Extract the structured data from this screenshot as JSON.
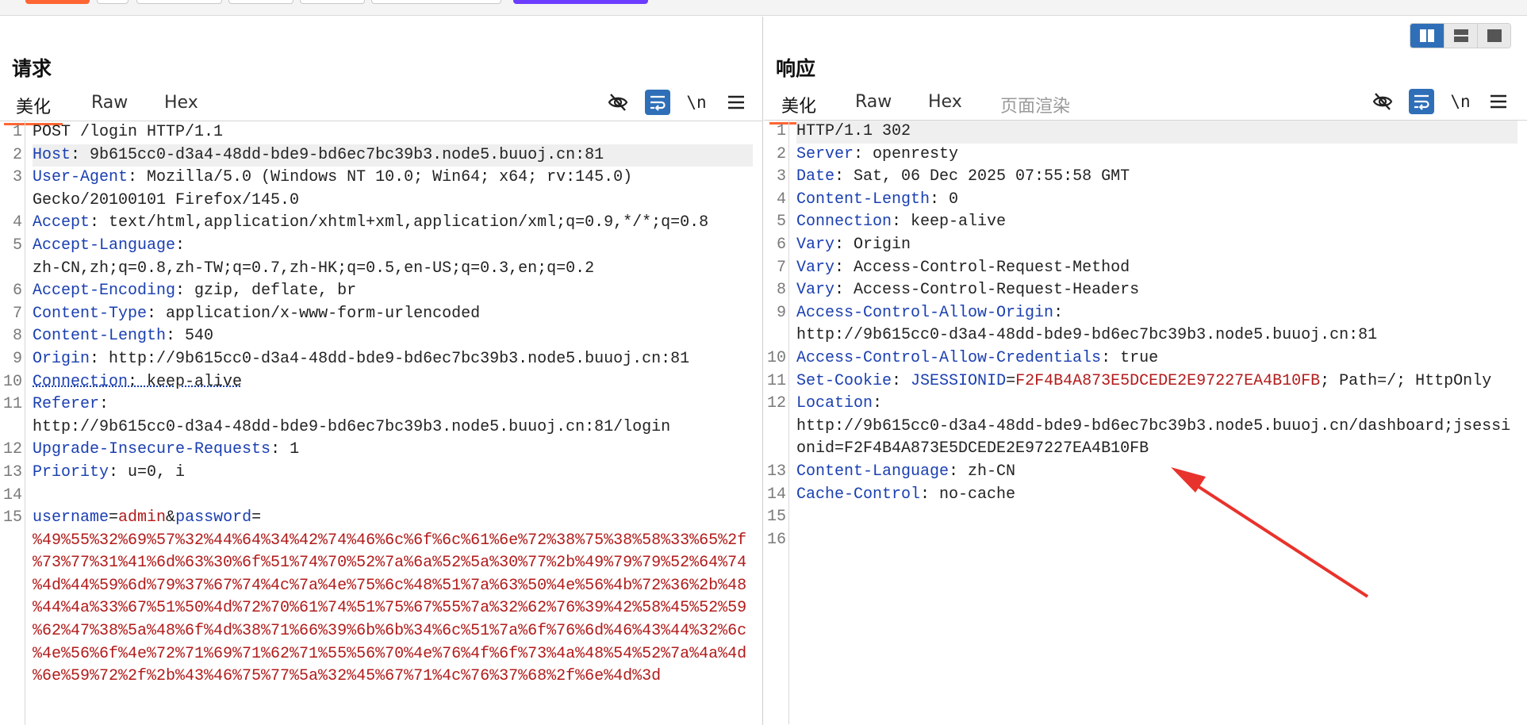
{
  "request": {
    "title": "请求",
    "tabs": [
      "美化",
      "Raw",
      "Hex"
    ],
    "tools": {
      "hide_icon": "eye-off-icon",
      "wrap_icon": "wrap-icon",
      "newline_label": "\\n",
      "menu_icon": "hamburger-menu-icon"
    },
    "lines": [
      {
        "n": "1",
        "parts": [
          {
            "t": "POST /login HTTP/1.1",
            "c": "v"
          }
        ]
      },
      {
        "n": "2",
        "hl": true,
        "parts": [
          {
            "t": "Host",
            "c": "k"
          },
          {
            "t": ": 9b615cc0-d3a4-48dd-bde9-bd6ec7bc39b3.node5.buuoj.cn:81",
            "c": "v"
          }
        ]
      },
      {
        "n": "3",
        "parts": [
          {
            "t": "User-Agent",
            "c": "k"
          },
          {
            "t": ": Mozilla/5.0 (Windows NT 10.0; Win64; x64; rv:145.0)",
            "c": "v"
          }
        ]
      },
      {
        "n": "",
        "parts": [
          {
            "t": "Gecko/20100101 Firefox/145.0",
            "c": "v"
          }
        ]
      },
      {
        "n": "4",
        "parts": [
          {
            "t": "Accept",
            "c": "k"
          },
          {
            "t": ": text/html,application/xhtml+xml,application/xml;q=0.9,*/*;q=0.8",
            "c": "v"
          }
        ]
      },
      {
        "n": "5",
        "parts": [
          {
            "t": "Accept-Language",
            "c": "k"
          },
          {
            "t": ":",
            "c": "v"
          }
        ]
      },
      {
        "n": "",
        "parts": [
          {
            "t": "zh-CN,zh;q=0.8,zh-TW;q=0.7,zh-HK;q=0.5,en-US;q=0.3,en;q=0.2",
            "c": "v"
          }
        ]
      },
      {
        "n": "6",
        "parts": [
          {
            "t": "Accept-Encoding",
            "c": "k"
          },
          {
            "t": ": gzip, deflate, br",
            "c": "v"
          }
        ]
      },
      {
        "n": "7",
        "parts": [
          {
            "t": "Content-Type",
            "c": "k"
          },
          {
            "t": ": application/x-www-form-urlencoded",
            "c": "v"
          }
        ]
      },
      {
        "n": "8",
        "parts": [
          {
            "t": "Content-Length",
            "c": "k"
          },
          {
            "t": ": 540",
            "c": "v"
          }
        ]
      },
      {
        "n": "9",
        "parts": [
          {
            "t": "Origin",
            "c": "k"
          },
          {
            "t": ": http://9b615cc0-d3a4-48dd-bde9-bd6ec7bc39b3.node5.buuoj.cn:81",
            "c": "v"
          }
        ]
      },
      {
        "n": "10",
        "parts": [
          {
            "t": "Connection",
            "c": "k dotted"
          },
          {
            "t": ": keep-alive",
            "c": "v dotted"
          }
        ]
      },
      {
        "n": "11",
        "parts": [
          {
            "t": "Referer",
            "c": "k"
          },
          {
            "t": ":",
            "c": "v"
          }
        ]
      },
      {
        "n": "",
        "parts": [
          {
            "t": "http://9b615cc0-d3a4-48dd-bde9-bd6ec7bc39b3.node5.buuoj.cn:81/login",
            "c": "v"
          }
        ]
      },
      {
        "n": "12",
        "parts": [
          {
            "t": "Upgrade-Insecure-Requests",
            "c": "k"
          },
          {
            "t": ": 1",
            "c": "v"
          }
        ]
      },
      {
        "n": "13",
        "parts": [
          {
            "t": "Priority",
            "c": "k"
          },
          {
            "t": ": u=0, i",
            "c": "v"
          }
        ]
      },
      {
        "n": "14",
        "parts": [
          {
            "t": "",
            "c": "v"
          }
        ]
      },
      {
        "n": "15",
        "parts": [
          {
            "t": "username",
            "c": "k"
          },
          {
            "t": "=",
            "c": "v"
          },
          {
            "t": "admin",
            "c": "r"
          },
          {
            "t": "&",
            "c": "v"
          },
          {
            "t": "password",
            "c": "k"
          },
          {
            "t": "=",
            "c": "v"
          }
        ]
      },
      {
        "n": "",
        "parts": [
          {
            "t": "%49%55%32%69%57%32%44%64%34%42%74%46%6c%6f%6c%61%6e%72%38%75%38%58%33%65%2f",
            "c": "r"
          }
        ]
      },
      {
        "n": "",
        "parts": [
          {
            "t": "%73%77%31%41%6d%63%30%6f%51%74%70%52%7a%6a%52%5a%30%77%2b%49%79%79%52%64%74",
            "c": "r"
          }
        ]
      },
      {
        "n": "",
        "parts": [
          {
            "t": "%4d%44%59%6d%79%37%67%74%4c%7a%4e%75%6c%48%51%7a%63%50%4e%56%4b%72%36%2b%48",
            "c": "r"
          }
        ]
      },
      {
        "n": "",
        "parts": [
          {
            "t": "%44%4a%33%67%51%50%4d%72%70%61%74%51%75%67%55%7a%32%62%76%39%42%58%45%52%59",
            "c": "r"
          }
        ]
      },
      {
        "n": "",
        "parts": [
          {
            "t": "%62%47%38%5a%48%6f%4d%38%71%66%39%6b%6b%34%6c%51%7a%6f%76%6d%46%43%44%32%6c",
            "c": "r"
          }
        ]
      },
      {
        "n": "",
        "parts": [
          {
            "t": "%4e%56%6f%4e%72%71%69%71%62%71%55%56%70%4e%76%4f%6f%73%4a%48%54%52%7a%4a%4d",
            "c": "r"
          }
        ]
      },
      {
        "n": "",
        "parts": [
          {
            "t": "%6e%59%72%2f%2b%43%46%75%77%5a%32%45%67%71%4c%76%37%68%2f%6e%4d%3d",
            "c": "r"
          }
        ]
      }
    ]
  },
  "response": {
    "title": "响应",
    "tabs": [
      "美化",
      "Raw",
      "Hex",
      "页面渲染"
    ],
    "tools": {
      "hide_icon": "eye-off-icon",
      "wrap_icon": "wrap-icon",
      "newline_label": "\\n",
      "menu_icon": "hamburger-menu-icon"
    },
    "lines": [
      {
        "n": "1",
        "hl": true,
        "parts": [
          {
            "t": "HTTP/1.1 302",
            "c": "v"
          }
        ]
      },
      {
        "n": "2",
        "parts": [
          {
            "t": "Server",
            "c": "k"
          },
          {
            "t": ": openresty",
            "c": "v"
          }
        ]
      },
      {
        "n": "3",
        "parts": [
          {
            "t": "Date",
            "c": "k"
          },
          {
            "t": ": Sat, 06 Dec 2025 07:55:58 GMT",
            "c": "v"
          }
        ]
      },
      {
        "n": "4",
        "parts": [
          {
            "t": "Content-Length",
            "c": "k"
          },
          {
            "t": ": 0",
            "c": "v"
          }
        ]
      },
      {
        "n": "5",
        "parts": [
          {
            "t": "Connection",
            "c": "k"
          },
          {
            "t": ": keep-alive",
            "c": "v"
          }
        ]
      },
      {
        "n": "6",
        "parts": [
          {
            "t": "Vary",
            "c": "k"
          },
          {
            "t": ": Origin",
            "c": "v"
          }
        ]
      },
      {
        "n": "7",
        "parts": [
          {
            "t": "Vary",
            "c": "k"
          },
          {
            "t": ": Access-Control-Request-Method",
            "c": "v"
          }
        ]
      },
      {
        "n": "8",
        "parts": [
          {
            "t": "Vary",
            "c": "k"
          },
          {
            "t": ": Access-Control-Request-Headers",
            "c": "v"
          }
        ]
      },
      {
        "n": "9",
        "parts": [
          {
            "t": "Access-Control-Allow-Origin",
            "c": "k"
          },
          {
            "t": ":",
            "c": "v"
          }
        ]
      },
      {
        "n": "",
        "parts": [
          {
            "t": "http://9b615cc0-d3a4-48dd-bde9-bd6ec7bc39b3.node5.buuoj.cn:81",
            "c": "v"
          }
        ]
      },
      {
        "n": "10",
        "parts": [
          {
            "t": "Access-Control-Allow-Credentials",
            "c": "k"
          },
          {
            "t": ": true",
            "c": "v"
          }
        ]
      },
      {
        "n": "11",
        "parts": [
          {
            "t": "Set-Cookie",
            "c": "k"
          },
          {
            "t": ": ",
            "c": "v"
          },
          {
            "t": "JSESSIONID",
            "c": "k"
          },
          {
            "t": "=",
            "c": "v"
          },
          {
            "t": "F2F4B4A873E5DCEDE2E97227EA4B10FB",
            "c": "r"
          },
          {
            "t": "; Path=/; HttpOnly",
            "c": "v"
          }
        ]
      },
      {
        "n": "12",
        "parts": [
          {
            "t": "Location",
            "c": "k"
          },
          {
            "t": ":",
            "c": "v"
          }
        ]
      },
      {
        "n": "",
        "parts": [
          {
            "t": "http://9b615cc0-d3a4-48dd-bde9-bd6ec7bc39b3.node5.buuoj.cn/dashboard;jsessi",
            "c": "v"
          }
        ]
      },
      {
        "n": "",
        "parts": [
          {
            "t": "onid=F2F4B4A873E5DCEDE2E97227EA4B10FB",
            "c": "v"
          }
        ]
      },
      {
        "n": "13",
        "parts": [
          {
            "t": "Content-Language",
            "c": "k"
          },
          {
            "t": ": zh-CN",
            "c": "v"
          }
        ]
      },
      {
        "n": "14",
        "parts": [
          {
            "t": "Cache-Control",
            "c": "k"
          },
          {
            "t": ": no-cache",
            "c": "v"
          }
        ]
      },
      {
        "n": "15",
        "parts": [
          {
            "t": "",
            "c": "v"
          }
        ]
      },
      {
        "n": "16",
        "parts": [
          {
            "t": "",
            "c": "v"
          }
        ]
      }
    ]
  },
  "layout_buttons": [
    "split-horizontal-icon",
    "split-vertical-icon",
    "single-pane-icon"
  ],
  "annotation": {
    "arrow_color": "#e8332c",
    "arrow_icon": "red-arrow-annotation"
  },
  "colors": {
    "accent": "#ff6633",
    "header_key": "#1a3fb0",
    "value_red": "#b31b1b",
    "tool_blue": "#2f6fb8"
  }
}
